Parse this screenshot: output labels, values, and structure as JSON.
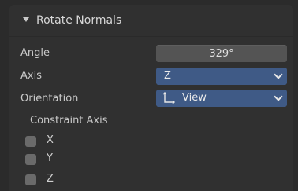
{
  "panel": {
    "title": "Rotate Normals",
    "angle": {
      "label": "Angle",
      "value": "329°"
    },
    "axis": {
      "label": "Axis",
      "value": "Z"
    },
    "orientation": {
      "label": "Orientation",
      "value": "View",
      "icon": "transform-orientation-icon"
    },
    "constraint_axis": {
      "label": "Constraint Axis",
      "options": [
        {
          "label": "X",
          "checked": false
        },
        {
          "label": "Y",
          "checked": false
        },
        {
          "label": "Z",
          "checked": false
        }
      ]
    }
  },
  "colors": {
    "dropdown_accent": "#3f5a86",
    "number_field": "#545454",
    "panel_bg": "#303030"
  }
}
